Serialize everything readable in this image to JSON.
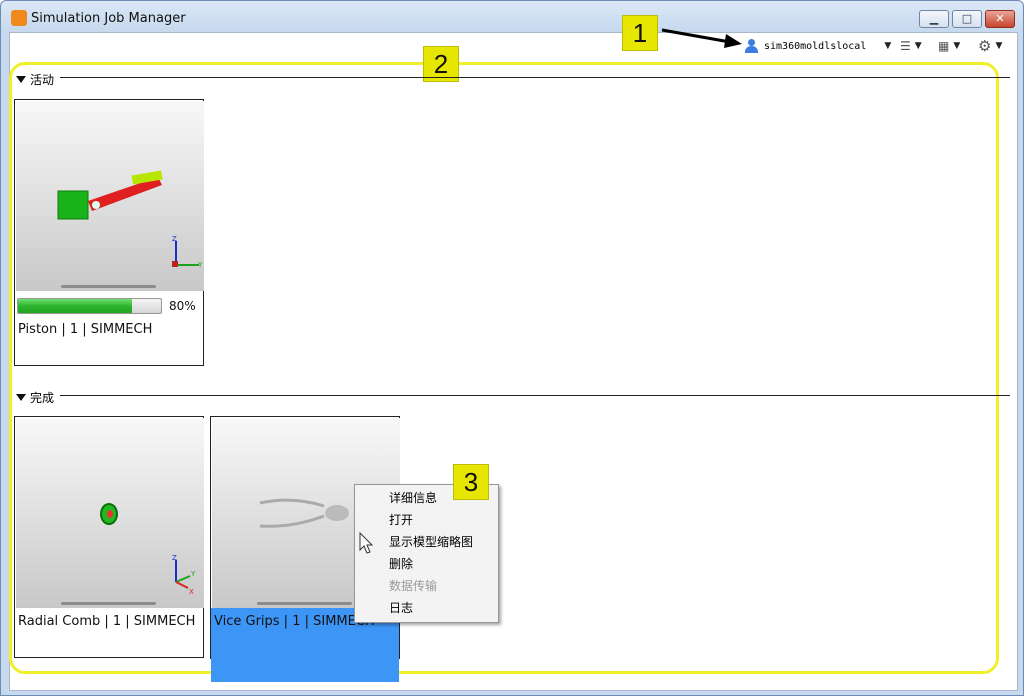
{
  "window": {
    "title": "Simulation Job Manager",
    "min_glyph": "▁",
    "max_glyph": "□",
    "close_glyph": "✕"
  },
  "toolbar": {
    "user": "sim360moldlslocal",
    "caret": "▼",
    "list_glyph": "☰",
    "grid_glyph": "▦",
    "gear_glyph": "⚙"
  },
  "callouts": [
    "1",
    "2",
    "3"
  ],
  "sections": {
    "active": "活动",
    "done": "完成"
  },
  "jobs": {
    "active": [
      {
        "label": "Piston | 1 | SIMMECH",
        "progress_text": "80%",
        "progress": 0.8
      }
    ],
    "done": [
      {
        "label": "Radial Comb | 1 | SIMMECH"
      },
      {
        "label": "Vice Grips | 1 | SIMMECH"
      }
    ]
  },
  "context_menu": {
    "items": [
      {
        "label": "详细信息",
        "enabled": true
      },
      {
        "label": "打开",
        "enabled": true
      },
      {
        "label": "显示模型缩略图",
        "enabled": true
      },
      {
        "label": "删除",
        "enabled": true
      },
      {
        "label": "数据传输",
        "enabled": false
      },
      {
        "label": "日志",
        "enabled": true
      }
    ]
  },
  "colors": {
    "callout": "#e6e600",
    "selection": "#3d95f5",
    "progress": "#2fb42f"
  }
}
